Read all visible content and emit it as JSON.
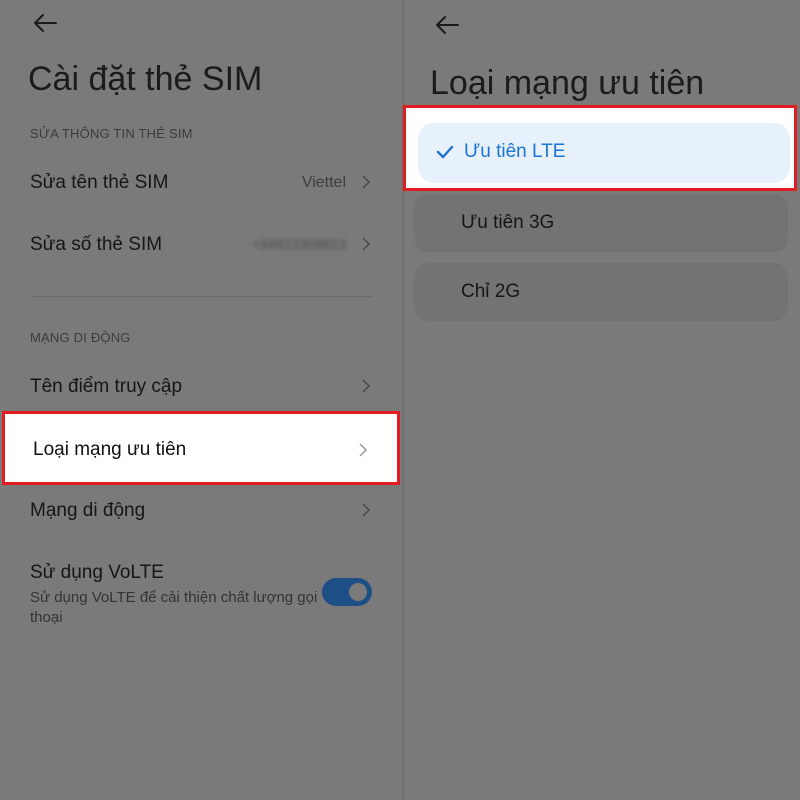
{
  "left": {
    "title": "Cài đặt thẻ SIM",
    "section_edit": "SỬA THÔNG TIN THẺ SIM",
    "rows_edit": [
      {
        "label": "Sửa tên thẻ SIM",
        "value": "Viettel"
      },
      {
        "label": "Sửa số thẻ SIM",
        "value": "+84913308813"
      }
    ],
    "section_mobile": "MẠNG DI ĐỘNG",
    "rows_mobile": [
      {
        "label": "Tên điểm truy cập"
      },
      {
        "label": "Loại mạng ưu tiên"
      },
      {
        "label": "Mạng di động"
      }
    ],
    "volte": {
      "title": "Sử dụng VoLTE",
      "description": "Sử dụng VoLTE để cải thiện chất lượng gọi thoại",
      "enabled": true
    }
  },
  "right": {
    "title": "Loại mạng ưu tiên",
    "options": [
      {
        "label": "Ưu tiên LTE",
        "selected": true
      },
      {
        "label": "Ưu tiên 3G",
        "selected": false
      },
      {
        "label": "Chỉ 2G",
        "selected": false
      }
    ]
  },
  "colors": {
    "highlight_border": "#e21c23",
    "selected_text": "#1a74d2",
    "selected_bg": "#e7f1fb",
    "toggle_on": "#1d4f86",
    "dim_background": "#7a7a7a"
  },
  "icons": {
    "back": "arrow-left-icon",
    "chevron": "chevron-right-icon",
    "check": "check-icon"
  }
}
